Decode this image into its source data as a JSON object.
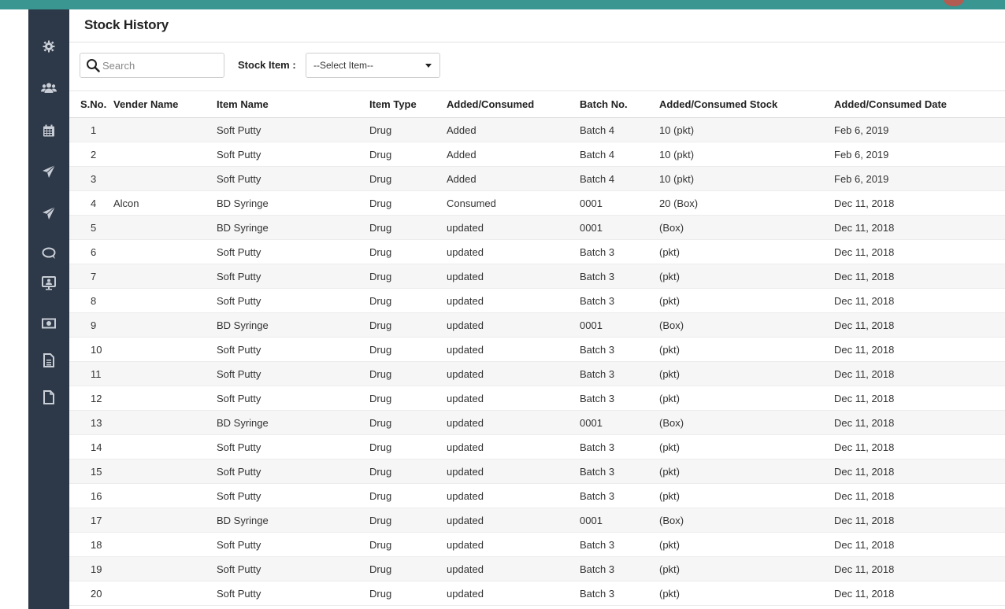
{
  "page": {
    "title": "Stock History"
  },
  "filters": {
    "search_placeholder": "Search",
    "stock_item_label": "Stock Item :",
    "stock_item_selected": "--Select Item--"
  },
  "sidebar": {
    "icons": [
      "settings-icon",
      "users-icon",
      "calendar-icon",
      "send-icon",
      "send-icon",
      "chat-icon",
      "monitor-user-icon",
      "money-icon",
      "document-text-icon",
      "document-icon"
    ]
  },
  "table": {
    "columns": [
      "S.No.",
      "Vender Name",
      "Item Name",
      "Item Type",
      "Added/Consumed",
      "Batch No.",
      "Added/Consumed Stock",
      "Added/Consumed Date"
    ],
    "rows": [
      [
        "1",
        "",
        "Soft Putty",
        "Drug",
        "Added",
        "Batch 4",
        "10 (pkt)",
        "Feb 6, 2019"
      ],
      [
        "2",
        "",
        "Soft Putty",
        "Drug",
        "Added",
        "Batch 4",
        "10 (pkt)",
        "Feb 6, 2019"
      ],
      [
        "3",
        "",
        "Soft Putty",
        "Drug",
        "Added",
        "Batch 4",
        "10 (pkt)",
        "Feb 6, 2019"
      ],
      [
        "4",
        "Alcon",
        "BD Syringe",
        "Drug",
        "Consumed",
        "0001",
        "20 (Box)",
        "Dec 11, 2018"
      ],
      [
        "5",
        "",
        "BD Syringe",
        "Drug",
        "updated",
        "0001",
        "(Box)",
        "Dec 11, 2018"
      ],
      [
        "6",
        "",
        "Soft Putty",
        "Drug",
        "updated",
        "Batch 3",
        "(pkt)",
        "Dec 11, 2018"
      ],
      [
        "7",
        "",
        "Soft Putty",
        "Drug",
        "updated",
        "Batch 3",
        "(pkt)",
        "Dec 11, 2018"
      ],
      [
        "8",
        "",
        "Soft Putty",
        "Drug",
        "updated",
        "Batch 3",
        "(pkt)",
        "Dec 11, 2018"
      ],
      [
        "9",
        "",
        "BD Syringe",
        "Drug",
        "updated",
        "0001",
        "(Box)",
        "Dec 11, 2018"
      ],
      [
        "10",
        "",
        "Soft Putty",
        "Drug",
        "updated",
        "Batch 3",
        "(pkt)",
        "Dec 11, 2018"
      ],
      [
        "11",
        "",
        "Soft Putty",
        "Drug",
        "updated",
        "Batch 3",
        "(pkt)",
        "Dec 11, 2018"
      ],
      [
        "12",
        "",
        "Soft Putty",
        "Drug",
        "updated",
        "Batch 3",
        "(pkt)",
        "Dec 11, 2018"
      ],
      [
        "13",
        "",
        "BD Syringe",
        "Drug",
        "updated",
        "0001",
        "(Box)",
        "Dec 11, 2018"
      ],
      [
        "14",
        "",
        "Soft Putty",
        "Drug",
        "updated",
        "Batch 3",
        "(pkt)",
        "Dec 11, 2018"
      ],
      [
        "15",
        "",
        "Soft Putty",
        "Drug",
        "updated",
        "Batch 3",
        "(pkt)",
        "Dec 11, 2018"
      ],
      [
        "16",
        "",
        "Soft Putty",
        "Drug",
        "updated",
        "Batch 3",
        "(pkt)",
        "Dec 11, 2018"
      ],
      [
        "17",
        "",
        "BD Syringe",
        "Drug",
        "updated",
        "0001",
        "(Box)",
        "Dec 11, 2018"
      ],
      [
        "18",
        "",
        "Soft Putty",
        "Drug",
        "updated",
        "Batch 3",
        "(pkt)",
        "Dec 11, 2018"
      ],
      [
        "19",
        "",
        "Soft Putty",
        "Drug",
        "updated",
        "Batch 3",
        "(pkt)",
        "Dec 11, 2018"
      ],
      [
        "20",
        "",
        "Soft Putty",
        "Drug",
        "updated",
        "Batch 3",
        "(pkt)",
        "Dec 11, 2018"
      ]
    ]
  }
}
